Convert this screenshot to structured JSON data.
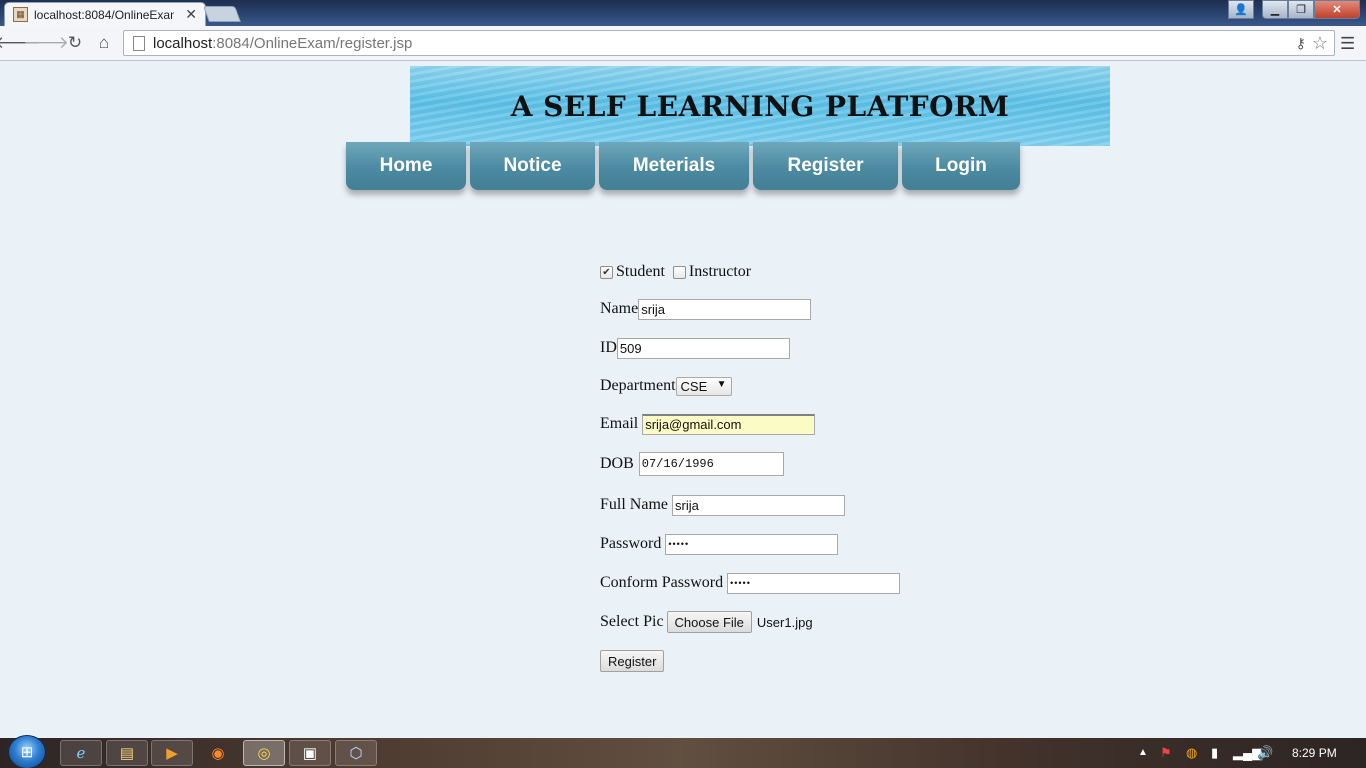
{
  "browser": {
    "tab_title": "localhost:8084/OnlineExam",
    "url_host": "localhost",
    "url_rest": ":8084/OnlineExam/register.jsp"
  },
  "page": {
    "banner_title": "A SELF LEARNING PLATFORM",
    "nav": [
      "Home",
      "Notice",
      "Meterials",
      "Register",
      "Login"
    ]
  },
  "form": {
    "role": {
      "student_label": "Student",
      "student_checked": true,
      "instructor_label": "Instructor",
      "instructor_checked": false
    },
    "name": {
      "label": "Name",
      "value": "srija"
    },
    "id": {
      "label": "ID",
      "value": "509"
    },
    "department": {
      "label": "Department",
      "selected": "CSE"
    },
    "email": {
      "label": "Email",
      "value": "srija@gmail.com"
    },
    "dob": {
      "label": "DOB",
      "value": "07/16/1996"
    },
    "full_name": {
      "label": "Full Name",
      "value": "srija"
    },
    "password": {
      "label": "Password",
      "masked": "•••••"
    },
    "confirm_password": {
      "label": "Conform Password",
      "masked": "•••••"
    },
    "picture": {
      "label": "Select Pic",
      "button": "Choose File",
      "filename": "User1.jpg"
    },
    "submit_label": "Register"
  },
  "taskbar": {
    "clock": "8:29 PM"
  }
}
